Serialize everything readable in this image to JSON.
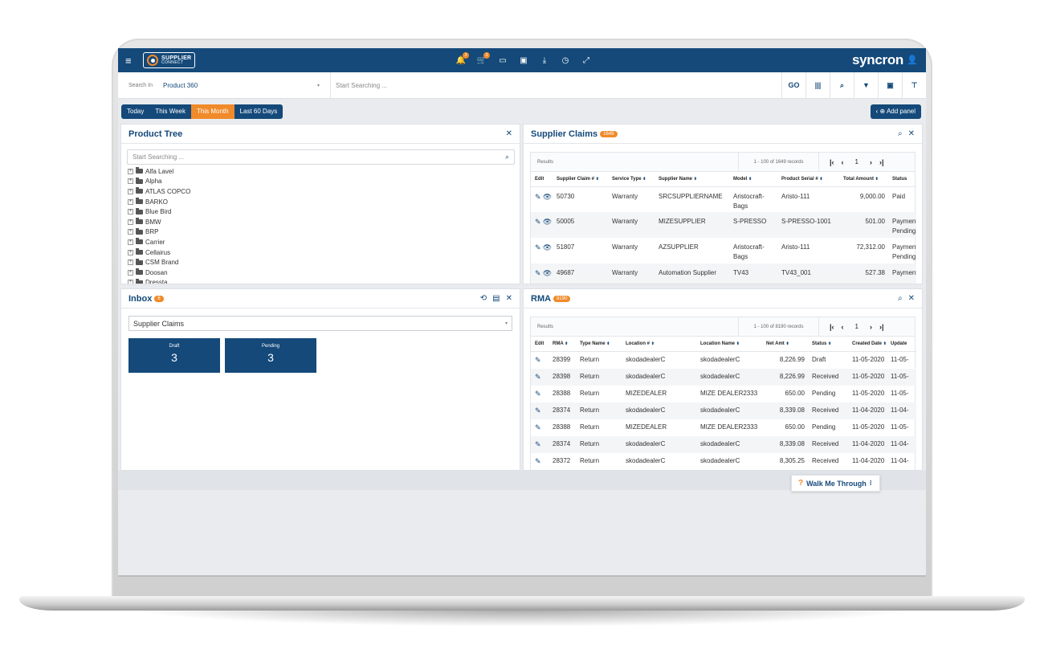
{
  "topbar": {
    "logo_line1": "SUPPLIER",
    "logo_line2": "CONNECT",
    "brand": "syncron",
    "nav_icons": [
      {
        "name": "bell-icon",
        "glyph": "🔔",
        "badge": "3"
      },
      {
        "name": "cart-icon",
        "glyph": "🛒",
        "badge": "3"
      },
      {
        "name": "printer-icon",
        "glyph": "▭",
        "badge": ""
      },
      {
        "name": "edit-icon",
        "glyph": "▣",
        "badge": ""
      },
      {
        "name": "download-icon",
        "glyph": "⤓",
        "badge": ""
      },
      {
        "name": "clock-icon",
        "glyph": "◷",
        "badge": ""
      },
      {
        "name": "expand-icon",
        "glyph": "⤢",
        "badge": ""
      }
    ]
  },
  "search": {
    "label": "Search In",
    "scope": "Product 360",
    "placeholder": "Start Searching ...",
    "go_label": "GO"
  },
  "date_filters": [
    "Today",
    "This Week",
    "This Month",
    "Last 60 Days"
  ],
  "active_date_filter": "This Month",
  "add_panel_label": "Add panel",
  "product_tree": {
    "title": "Product Tree",
    "search_placeholder": "Start Searching ...",
    "items": [
      "Alfa Lavel",
      "Alpha",
      "ATLAS COPCO",
      "BARKO",
      "Blue Bird",
      "BMW",
      "BRP",
      "Carrier",
      "Cellairus",
      "CSM Brand",
      "Doosan",
      "Dressta"
    ]
  },
  "inbox": {
    "title": "Inbox",
    "badge": "6",
    "selected": "Supplier Claims",
    "tiles": [
      {
        "label": "Draft",
        "count": "3"
      },
      {
        "label": "Pending",
        "count": "3"
      }
    ]
  },
  "supplier_claims": {
    "title": "Supplier Claims",
    "badge": "1649",
    "results_label": "Results",
    "records": "1 - 100 of 1649 records",
    "page": "1",
    "columns": [
      "Edit",
      "Supplier Claim #",
      "Service Type",
      "Supplier Name",
      "Model",
      "Product Serial #",
      "Total Amount",
      "Status"
    ],
    "rows": [
      {
        "claim": "50730",
        "service": "Warranty",
        "supplier": "SRCSUPPLIERNAME",
        "model": "Aristocraft-Bags",
        "serial": "Aristo-111",
        "amount": "9,000.00",
        "status": "Paid"
      },
      {
        "claim": "50005",
        "service": "Warranty",
        "supplier": "MIZESUPPLIER",
        "model": "S-PRESSO",
        "serial": "S-PRESSO-1001",
        "amount": "501.00",
        "status": "Payment Pending"
      },
      {
        "claim": "51807",
        "service": "Warranty",
        "supplier": "AZSUPPLIER",
        "model": "Aristocraft-Bags",
        "serial": "Aristo-111",
        "amount": "72,312.00",
        "status": "Payment Pending"
      },
      {
        "claim": "49687",
        "service": "Warranty",
        "supplier": "Automation Supplier",
        "model": "TV43",
        "serial": "TV43_001",
        "amount": "527.38",
        "status": "Payment"
      }
    ]
  },
  "rma": {
    "title": "RMA",
    "badge": "8190",
    "results_label": "Results",
    "records": "1 - 100 of 8190 records",
    "page": "1",
    "columns": [
      "Edit",
      "RMA",
      "Type Name",
      "Location #",
      "Location Name",
      "Net Amt",
      "Status",
      "Created Date",
      "Update"
    ],
    "rows": [
      {
        "rma": "28399",
        "type": "Return",
        "loc": "skodadealerC",
        "locname": "skodadealerC",
        "net": "8,226.99",
        "status": "Draft",
        "created": "11-05-2020",
        "updated": "11-05-"
      },
      {
        "rma": "28398",
        "type": "Return",
        "loc": "skodadealerC",
        "locname": "skodadealerC",
        "net": "8,226.99",
        "status": "Received",
        "created": "11-05-2020",
        "updated": "11-05-"
      },
      {
        "rma": "28388",
        "type": "Return",
        "loc": "MIZEDEALER",
        "locname": "MIZE DEALER2333",
        "net": "650.00",
        "status": "Pending",
        "created": "11-05-2020",
        "updated": "11-05-"
      },
      {
        "rma": "28374",
        "type": "Return",
        "loc": "skodadealerC",
        "locname": "skodadealerC",
        "net": "8,339.08",
        "status": "Received",
        "created": "11-04-2020",
        "updated": "11-04-"
      },
      {
        "rma": "28388",
        "type": "Return",
        "loc": "MIZEDEALER",
        "locname": "MIZE DEALER2333",
        "net": "650.00",
        "status": "Pending",
        "created": "11-05-2020",
        "updated": "11-05-"
      },
      {
        "rma": "28374",
        "type": "Return",
        "loc": "skodadealerC",
        "locname": "skodadealerC",
        "net": "8,339.08",
        "status": "Received",
        "created": "11-04-2020",
        "updated": "11-04-"
      },
      {
        "rma": "28372",
        "type": "Return",
        "loc": "skodadealerC",
        "locname": "skodadealerC",
        "net": "8,305.25",
        "status": "Received",
        "created": "11-04-2020",
        "updated": "11-04-"
      }
    ]
  },
  "walkme_label": "Walk Me Through",
  "colors": {
    "primary": "#14497a",
    "accent": "#f08a2a"
  }
}
